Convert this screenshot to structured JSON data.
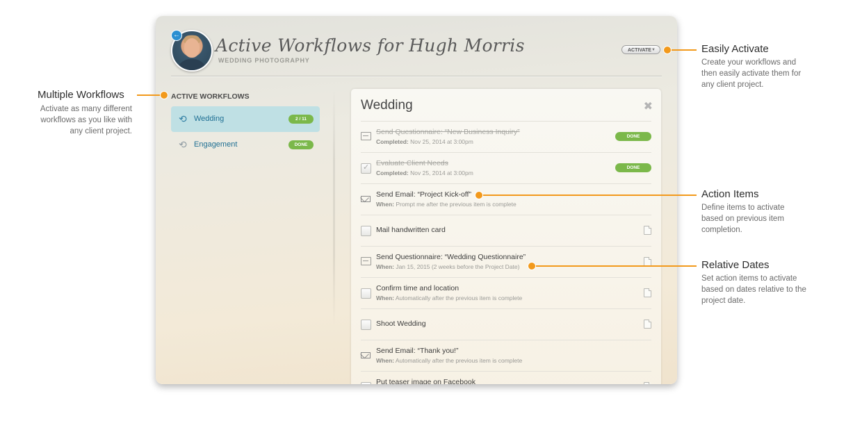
{
  "header": {
    "title": "Active Workflows for Hugh Morris",
    "subtitle": "WEDDING PHOTOGRAPHY",
    "activate_label": "ACTIVATE",
    "caret": "▼",
    "back_icon": "←"
  },
  "sidebar": {
    "heading": "ACTIVE WORKFLOWS",
    "items": [
      {
        "label": "Wedding",
        "badge": "2 / 11",
        "icon": "⟲"
      },
      {
        "label": "Engagement",
        "badge": "DONE",
        "icon": "⟲"
      }
    ]
  },
  "panel": {
    "title": "Wedding",
    "close_glyph": "✖",
    "rows": [
      {
        "title": "Send Questionnaire: “New Business Inquiry”",
        "sub_label": "Completed:",
        "sub_value": " Nov 25, 2014 at 3:00pm",
        "status": "DONE",
        "icon": "card-icon"
      },
      {
        "title": "Evaluate Client Needs",
        "sub_label": "Completed:",
        "sub_value": " Nov 25, 2014 at 3:00pm",
        "status": "DONE",
        "icon": "checkbox-checked"
      },
      {
        "title": "Send Email: “Project Kick-off”",
        "sub_label": "When:",
        "sub_value": " Prompt me after the previous item is complete",
        "icon": "mail-icon"
      },
      {
        "title": "Mail handwritten card",
        "icon": "checkbox"
      },
      {
        "title": "Send Questionnaire: “Wedding Questionnaire”",
        "sub_label": "When:",
        "sub_value": " Jan 15, 2015  (2 weeks before the Project Date)",
        "icon": "card-icon"
      },
      {
        "title": "Confirm time and location",
        "sub_label": "When:",
        "sub_value": " Automatically after the previous item is complete",
        "icon": "checkbox"
      },
      {
        "title": "Shoot Wedding",
        "icon": "checkbox"
      },
      {
        "title": "Send Email: “Thank you!”",
        "sub_label": "When:",
        "sub_value": " Automatically after the previous item is complete",
        "icon": "mail-icon"
      },
      {
        "title": "Put teaser image on Facebook",
        "icon": "checkbox"
      }
    ]
  },
  "callouts": {
    "multiple": {
      "title": "Multiple Workflows",
      "desc": "Activate as many different workflows as you like with any client project."
    },
    "activate": {
      "title": "Easily Activate",
      "desc": "Create your workflows and then easily activate them for any client project."
    },
    "actions": {
      "title": "Action Items",
      "desc": "Define items to activate based on previous item completion."
    },
    "dates": {
      "title": "Relative Dates",
      "desc": "Set action items to activate based on dates relative to the project date."
    }
  },
  "colors": {
    "accent": "#f2991b",
    "done_green": "#7bb84a",
    "selected_bg": "#bfe0e4",
    "link_blue": "#1e6f93"
  }
}
